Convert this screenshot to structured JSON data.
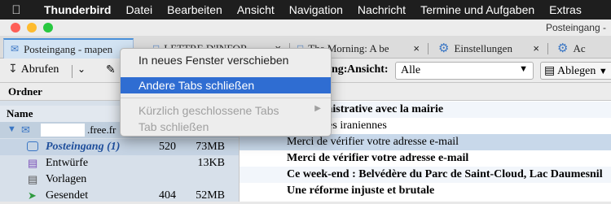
{
  "menubar": {
    "app_name": "Thunderbird",
    "items": [
      "Datei",
      "Bearbeiten",
      "Ansicht",
      "Navigation",
      "Nachricht",
      "Termine und Aufgaben",
      "Extras"
    ]
  },
  "window": {
    "title": "Posteingang - ",
    "traffic_colors": [
      "#fe5f57",
      "#febb2e",
      "#28c840"
    ]
  },
  "tabs": [
    {
      "label": "Posteingang - mapen",
      "icon": "inbox-icon",
      "active": true
    },
    {
      "label": "LETTRE D'INFOR",
      "icon": "document-icon",
      "active": false
    },
    {
      "label": "The Morning: A be",
      "icon": "document-icon",
      "active": false
    },
    {
      "label": "Einstellungen",
      "icon": "gear-icon",
      "active": false
    },
    {
      "label": "Ac",
      "icon": "gear-icon",
      "active": false
    }
  ],
  "toolbar": {
    "get_messages": "Abrufen",
    "filter_label": "ng:",
    "view_label": "Ansicht:",
    "view_value": "Alle",
    "archive_label": "Ablegen"
  },
  "folder_pane": {
    "header": "Ordner",
    "column_name": "Name",
    "account_domain": ".free.fr",
    "folders": [
      {
        "name": "Posteingang (1)",
        "count": "520",
        "size": "73MB",
        "icon": "inbox-icon",
        "selected": true
      },
      {
        "name": "Entwürfe",
        "count": "",
        "size": "13KB",
        "icon": "drafts-icon",
        "selected": false
      },
      {
        "name": "Vorlagen",
        "count": "",
        "size": "",
        "icon": "templates-icon",
        "selected": false
      },
      {
        "name": "Gesendet",
        "count": "404",
        "size": "52MB",
        "icon": "sent-icon",
        "selected": false
      }
    ]
  },
  "message_list": {
    "rows": [
      {
        "subject": "on administrative avec la mairie",
        "bold": true,
        "selected": false
      },
      {
        "subject": "ux femmes iraniennes",
        "bold": false,
        "selected": false
      },
      {
        "subject": "Merci de vérifier votre adresse e-mail",
        "bold": false,
        "selected": true
      },
      {
        "subject": "Merci de vérifier votre adresse e-mail",
        "bold": true,
        "selected": false
      },
      {
        "subject": "Ce week-end : Belvédère du Parc de Saint-Cloud, Lac Daumesnil",
        "bold": true,
        "selected": false
      },
      {
        "subject": "Une réforme injuste et brutale",
        "bold": true,
        "selected": false
      }
    ]
  },
  "context_menu": {
    "items": [
      {
        "label": "In neues Fenster verschieben",
        "state": "normal"
      },
      {
        "label": "Andere Tabs schließen",
        "state": "highlighted"
      },
      {
        "label": "Kürzlich geschlossene Tabs",
        "state": "disabled",
        "submenu": true
      },
      {
        "label": "Tab schließen",
        "state": "disabled"
      }
    ]
  }
}
